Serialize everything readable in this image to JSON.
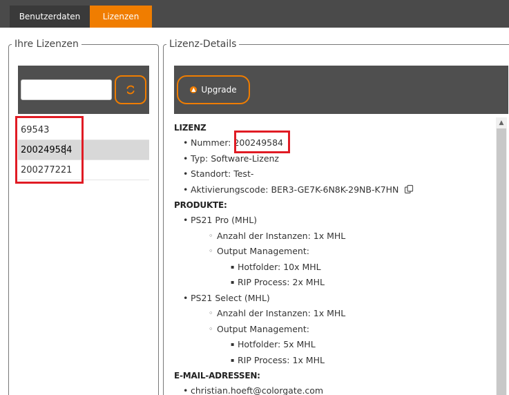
{
  "tabs": [
    {
      "label": "Benutzerdaten",
      "active": false
    },
    {
      "label": "Lizenzen",
      "active": true
    }
  ],
  "licenses_panel": {
    "legend": "Ihre Lizenzen",
    "search": {
      "value": "",
      "placeholder": ""
    },
    "refresh_icon": "refresh-icon",
    "items": [
      {
        "label": "69543",
        "selected": false
      },
      {
        "label": "200249584",
        "selected": true
      },
      {
        "label": "200277221",
        "selected": false
      }
    ]
  },
  "details_panel": {
    "legend": "Lizenz-Details",
    "upgrade_label": "Upgrade",
    "lizenz": {
      "heading": "LIZENZ",
      "nummer_label": "Nummer:",
      "nummer_value": "200249584",
      "typ": "Typ: Software-Lizenz",
      "standort": "Standort: Test-",
      "aktivierungscode": "Aktivierungscode: BER3-GE7K-6N8K-29NB-K7HN"
    },
    "produkte": {
      "heading": "PRODUKTE:",
      "items": [
        {
          "name": "PS21 Pro (MHL)",
          "instanzen": "Anzahl der Instanzen: 1x MHL",
          "output_label": "Output Management:",
          "hotfolder": "Hotfolder: 10x MHL",
          "rip": "RIP Process: 2x MHL"
        },
        {
          "name": "PS21 Select (MHL)",
          "instanzen": "Anzahl der Instanzen: 1x MHL",
          "output_label": "Output Management:",
          "hotfolder": "Hotfolder: 5x MHL",
          "rip": "RIP Process: 1x MHL"
        }
      ]
    },
    "email": {
      "heading": "E-MAIL-ADRESSEN:",
      "items": [
        "christian.hoeft@colorgate.com"
      ]
    }
  },
  "colors": {
    "accent": "#f07d00",
    "topbar": "#4a4a4a",
    "dark_band": "#4f4f4f",
    "highlight": "#e01b24"
  }
}
